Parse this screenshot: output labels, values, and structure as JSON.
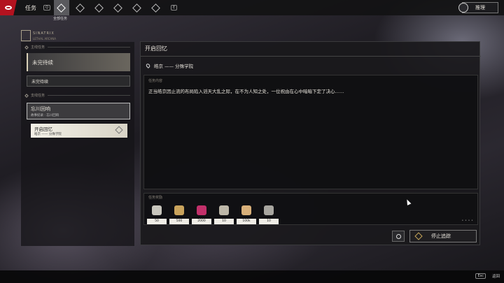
{
  "topbar": {
    "title": "任务",
    "key_left": "Q",
    "key_right": "E",
    "active_tab_label": "全部任务",
    "tabs": [
      "all-quests",
      "quest-tab-2",
      "quest-tab-3",
      "quest-tab-4",
      "quest-tab-5",
      "quest-tab-6"
    ],
    "reason_button": "推理"
  },
  "emblem": {
    "line1": "SINATRIX",
    "line2": "LETHAL ARCANA"
  },
  "left": {
    "main_section": "主线任务",
    "main_active": "未完待续",
    "main_sub": "未完待续",
    "side_section": "支线任务",
    "side_quest": {
      "name": "忘川回响",
      "desc": "故事纪录 · 忘川回响"
    },
    "side_current": {
      "name": "开启回忆",
      "desc": "皓京 —— 分殊学院"
    }
  },
  "detail": {
    "title": "开启回忆",
    "location": "皓京 —— 分殊学院",
    "content_label": "任务内容",
    "content_text": "正当皓京因止流的布局陷入滔天大乱之际，在不为人知之处，一位祝由在心中暗暗下定了决心……",
    "reward_label": "任务奖励",
    "rewards": [
      {
        "count": "50",
        "color": "#c8c6bd"
      },
      {
        "count": "500",
        "color": "#c9a35c"
      },
      {
        "count": "2000",
        "color": "#c2306a"
      },
      {
        "count": "10",
        "color": "#bdb7a8"
      },
      {
        "count": "100k",
        "color": "#d8b07a"
      },
      {
        "count": "10",
        "color": "#a8a6a0"
      }
    ],
    "stop_button": "停止追踪"
  },
  "bottom": {
    "esc_key": "Esc",
    "back_label": "返回"
  }
}
